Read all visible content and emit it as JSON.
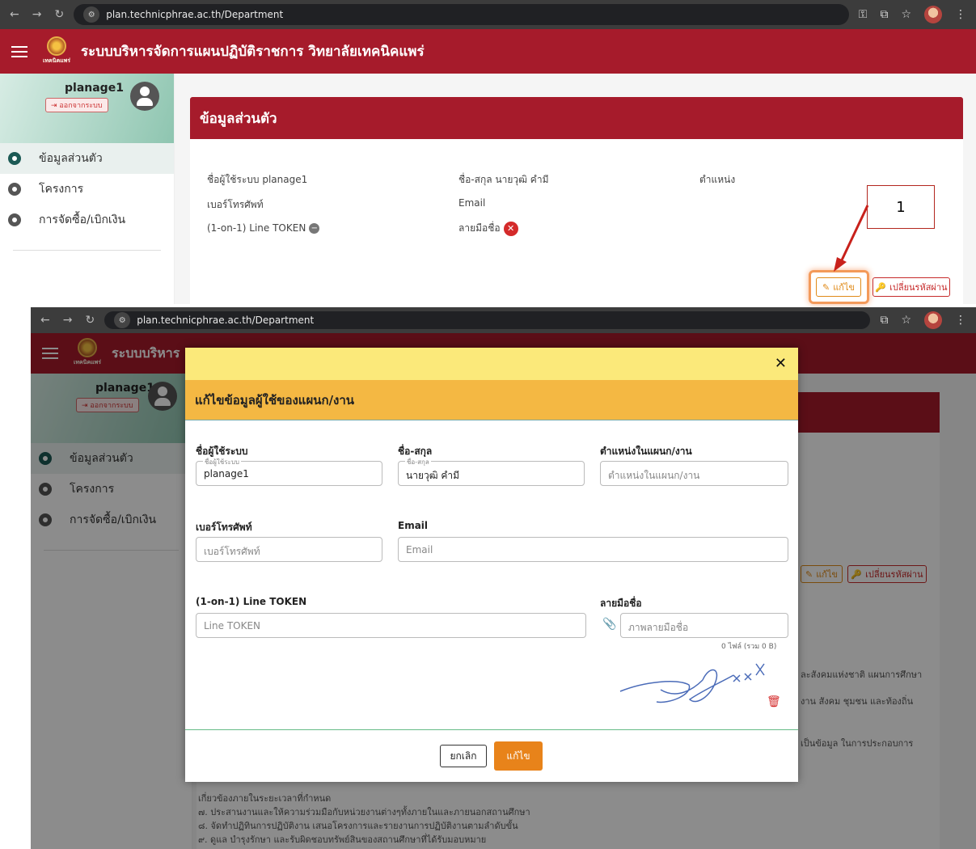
{
  "top": {
    "browser": {
      "url": "plan.technicphrae.ac.th/Department"
    },
    "app": {
      "title": "ระบบบริหารจัดการแผนปฏิบัติราชการ วิทยาลัยเทคนิคแพร่",
      "logo_text": "เทคนิคแพร่"
    },
    "sidebar": {
      "username": "planage1",
      "logout": "ออกจากระบบ",
      "items": [
        {
          "label": "ข้อมูลส่วนตัว"
        },
        {
          "label": "โครงการ"
        },
        {
          "label": "การจัดซื้อ/เบิกเงิน"
        }
      ]
    },
    "card": {
      "title": "ข้อมูลส่วนตัว",
      "username_line": "ชื่อผู้ใช้ระบบ planage1",
      "fullname_line": "ชื่อ-สกุล นายวุฒิ คำมี",
      "position_label": "ตำแหน่ง",
      "phone_label": "เบอร์โทรศัพท์",
      "email_label": "Email",
      "line_label": "(1-on-1) Line TOKEN",
      "signature_label": "ลายมือชื่อ",
      "edit_button": "แก้ไข",
      "change_password_button": "เปลี่ยนรหัสผ่าน"
    },
    "annotation": {
      "number": "1"
    }
  },
  "bottom": {
    "app": {
      "title_visible": "ระบบบริหาร"
    },
    "sidebar": {
      "username": "planage1",
      "logout": "ออกจากระบบ",
      "items": [
        {
          "label": "ข้อมูลส่วนตัว"
        },
        {
          "label": "โครงการ"
        },
        {
          "label": "การจัดซื้อ/เบิกเงิน"
        }
      ]
    },
    "modal": {
      "title": "แก้ไขข้อมูลผู้ใช้ของแผนก/งาน",
      "username_label": "ชื่อผู้ใช้ระบบ",
      "username_legend": "ชื่อผู้ใช้ระบบ",
      "username_value": "planage1",
      "fullname_label": "ชื่อ-สกุล",
      "fullname_legend": "ชื่อ-สกุล",
      "fullname_value": "นายวุฒิ คำมี",
      "position_label": "ตำแหน่งในแผนก/งาน",
      "position_placeholder": "ตำแหน่งในแผนก/งาน",
      "phone_label": "เบอร์โทรศัพท์",
      "phone_placeholder": "เบอร์โทรศัพท์",
      "email_label": "Email",
      "email_placeholder": "Email",
      "line_label": "(1-on-1) Line TOKEN",
      "line_placeholder": "Line TOKEN",
      "signature_label": "ลายมือชื่อ",
      "signature_placeholder": "ภาพลายมือชื่อ",
      "file_count": "0 ไฟล์ (รวม 0 B)",
      "cancel_button": "ยกเลิก",
      "save_button": "แก้ไข"
    },
    "background_buttons": {
      "edit": "แก้ไข",
      "change_password": "เปลี่ยนรหัสผ่าน"
    },
    "background_lines": [
      "ละสังคมแห่งชาติ แผนการศึกษา",
      "งาน สังคม ชุมชน และท้องถิ่น",
      "เป็นข้อมูล ในการประกอบการ",
      "เกี่ยวข้องภายในระยะเวลาที่กำหนด",
      "๗. ประสานงานและให้ความร่วมมือกับหน่วยงานต่างๆทั้งภายในและภายนอกสถานศึกษา",
      "๘. จัดทำปฏิทินการปฏิบัติงาน เสนอโครงการและรายงานการปฏิบัติงานตามลำดับขั้น",
      "๙. ดูแล บำรุงรักษา และรับผิดชอบทรัพย์สินของสถานศึกษาที่ได้รับมอบหมาย"
    ]
  }
}
